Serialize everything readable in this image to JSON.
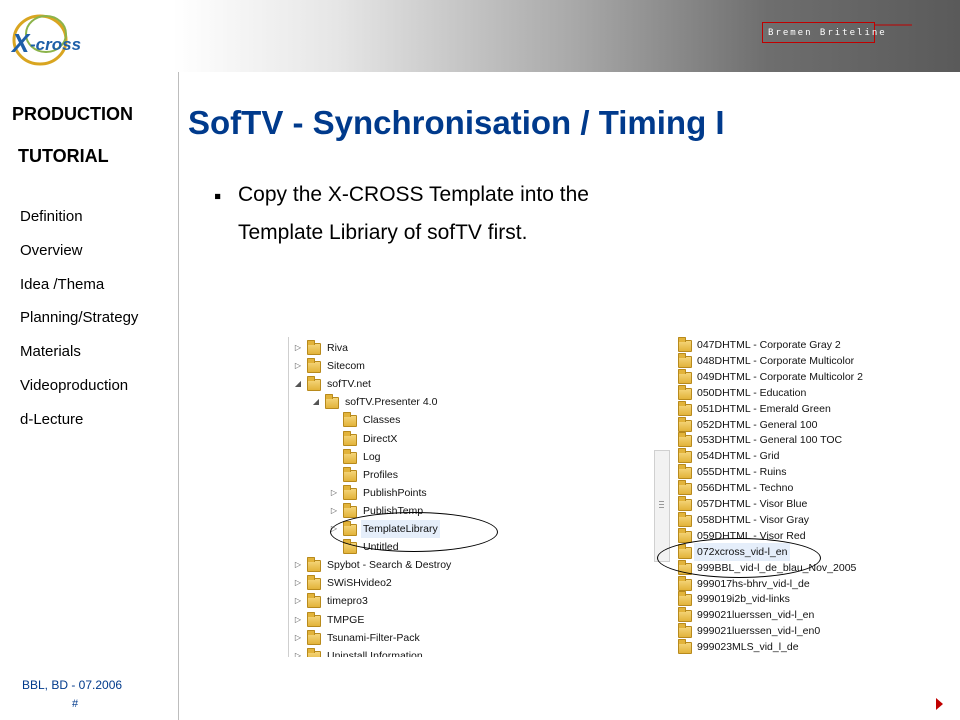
{
  "header": {
    "logo_text": "X-CROSS",
    "brand_label": "Bremen Briteline"
  },
  "sidebar": {
    "heading_line1": "PRODUCTION",
    "heading_line2": "TUTORIAL",
    "items": [
      "Definition",
      "Overview",
      "Idea /Thema",
      "Planning/Strategy",
      "Materials",
      "Videoproduction",
      "d-Lecture"
    ]
  },
  "main": {
    "title": "SofTV - Synchronisation / Timing I",
    "bullet_line1": "Copy the X-CROSS Template into the",
    "bullet_line2": "Template Libriary of sofTV first."
  },
  "left_tree": [
    {
      "label": "Riva",
      "level": 0,
      "expander": "▷"
    },
    {
      "label": "Sitecom",
      "level": 0,
      "expander": "▷"
    },
    {
      "label": "sofTV.net",
      "level": 0,
      "expander": "◢"
    },
    {
      "label": "sofTV.Presenter 4.0",
      "level": 1,
      "expander": "◢"
    },
    {
      "label": "Classes",
      "level": 2,
      "expander": ""
    },
    {
      "label": "DirectX",
      "level": 2,
      "expander": ""
    },
    {
      "label": "Log",
      "level": 2,
      "expander": ""
    },
    {
      "label": "Profiles",
      "level": 2,
      "expander": ""
    },
    {
      "label": "PublishPoints",
      "level": 2,
      "expander": "▷"
    },
    {
      "label": "PublishTemp",
      "level": 2,
      "expander": "▷"
    },
    {
      "label": "TemplateLibrary",
      "level": 2,
      "expander": "▷",
      "selected": true
    },
    {
      "label": "Untitled",
      "level": 2,
      "expander": ""
    },
    {
      "label": "Spybot - Search & Destroy",
      "level": 0,
      "expander": "▷"
    },
    {
      "label": "SWiSHvideo2",
      "level": 0,
      "expander": "▷"
    },
    {
      "label": "timepro3",
      "level": 0,
      "expander": "▷"
    },
    {
      "label": "TMPGE",
      "level": 0,
      "expander": "▷"
    },
    {
      "label": "Tsunami-Filter-Pack",
      "level": 0,
      "expander": "▷"
    },
    {
      "label": "Uninstall Information",
      "level": 0,
      "expander": "▷"
    }
  ],
  "right_list": [
    {
      "label": "047DHTML - Corporate Gray 2"
    },
    {
      "label": "048DHTML - Corporate Multicolor"
    },
    {
      "label": "049DHTML - Corporate Multicolor 2"
    },
    {
      "label": "050DHTML - Education"
    },
    {
      "label": "051DHTML - Emerald Green"
    },
    {
      "label": "052DHTML - General 100"
    },
    {
      "label": "053DHTML - General 100 TOC"
    },
    {
      "label": "054DHTML - Grid"
    },
    {
      "label": "055DHTML - Ruins"
    },
    {
      "label": "056DHTML - Techno"
    },
    {
      "label": "057DHTML - Visor Blue"
    },
    {
      "label": "058DHTML - Visor Gray"
    },
    {
      "label": "059DHTML - Visor Red"
    },
    {
      "label": "072xcross_vid-l_en",
      "selected": true
    },
    {
      "label": "999BBL_vid-l_de_blau_Nov_2005"
    },
    {
      "label": "999017hs-bhrv_vid-l_de"
    },
    {
      "label": "999019i2b_vid-links"
    },
    {
      "label": "999021luerssen_vid-l_en"
    },
    {
      "label": "999021luerssen_vid-l_en0"
    },
    {
      "label": "999023MLS_vid_l_de"
    }
  ],
  "footer": {
    "text": "BBL, BD - 07.2006",
    "page": "#"
  },
  "colors": {
    "title": "#003a8c",
    "arrow": "#c00000",
    "brand_border": "#c00000"
  }
}
